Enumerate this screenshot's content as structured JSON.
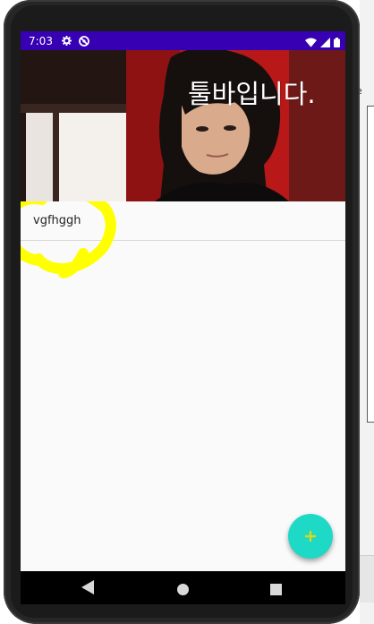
{
  "background": {
    "fragment_text": "e"
  },
  "status_bar": {
    "time": "7:03",
    "color": "#3700b3"
  },
  "header": {
    "title": "툴바입니다."
  },
  "list": {
    "items": [
      {
        "label": "vgfhggh"
      }
    ]
  },
  "fab": {
    "icon": "plus-icon",
    "color": "#1ed9c6"
  },
  "nav": {
    "back_icon": "back-triangle-icon",
    "home_icon": "home-circle-icon",
    "recents_icon": "recents-square-icon"
  },
  "annotation": {
    "color": "#ffff00"
  }
}
